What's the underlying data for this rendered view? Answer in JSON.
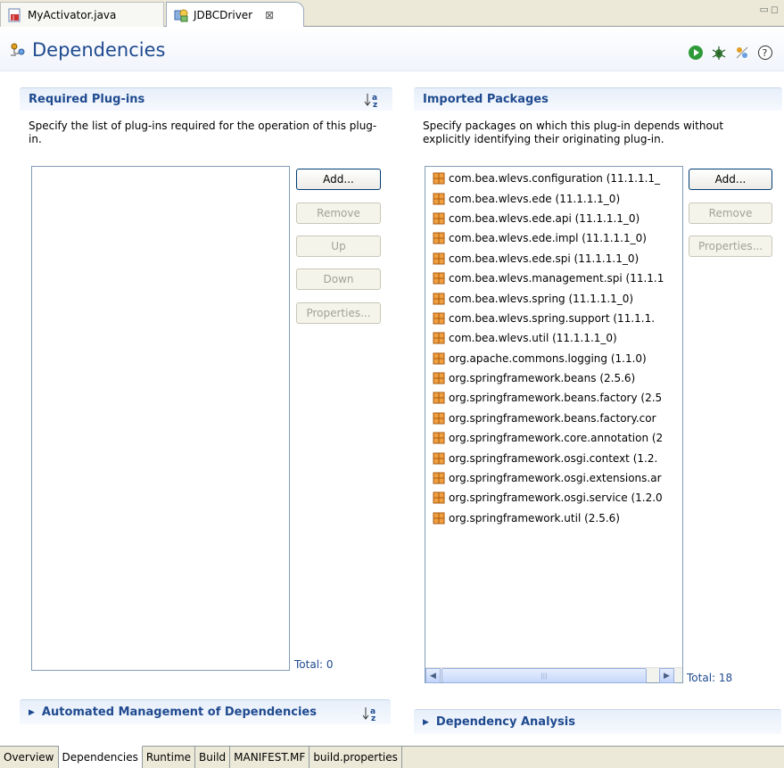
{
  "tabs": [
    {
      "label": "MyActivator.java",
      "icon": "java-file-icon"
    },
    {
      "label": "JDBCDriver",
      "icon": "plugin-manifest-icon",
      "close": "⊠"
    }
  ],
  "form": {
    "title": "Dependencies"
  },
  "required": {
    "title": "Required Plug-ins",
    "description": "Specify the list of plug-ins required for the operation of this plug-in.",
    "buttons": {
      "add": "Add...",
      "remove": "Remove",
      "up": "Up",
      "down": "Down",
      "properties": "Properties..."
    },
    "total": "Total: 0"
  },
  "imported": {
    "title": "Imported Packages",
    "description": "Specify packages on which this plug-in depends without explicitly identifying their originating plug-in.",
    "buttons": {
      "add": "Add...",
      "remove": "Remove",
      "properties": "Properties..."
    },
    "packages": [
      "com.bea.wlevs.configuration (11.1.1.1_",
      "com.bea.wlevs.ede (11.1.1.1_0)",
      "com.bea.wlevs.ede.api (11.1.1.1_0)",
      "com.bea.wlevs.ede.impl (11.1.1.1_0)",
      "com.bea.wlevs.ede.spi (11.1.1.1_0)",
      "com.bea.wlevs.management.spi (11.1.1",
      "com.bea.wlevs.spring (11.1.1.1_0)",
      "com.bea.wlevs.spring.support (11.1.1.",
      "com.bea.wlevs.util (11.1.1.1_0)",
      "org.apache.commons.logging (1.1.0)",
      "org.springframework.beans (2.5.6)",
      "org.springframework.beans.factory (2.5",
      "org.springframework.beans.factory.cor",
      "org.springframework.core.annotation (2",
      "org.springframework.osgi.context (1.2.",
      "org.springframework.osgi.extensions.ar",
      "org.springframework.osgi.service (1.2.0",
      "org.springframework.util (2.5.6)"
    ],
    "total": "Total: 18"
  },
  "automated": {
    "title": "Automated Management of Dependencies"
  },
  "analysis": {
    "title": "Dependency Analysis"
  },
  "page_tabs": [
    "Overview",
    "Dependencies",
    "Runtime",
    "Build",
    "MANIFEST.MF",
    "build.properties"
  ],
  "active_page_tab": "Dependencies",
  "colors": {
    "section_title": "#1f4a8f",
    "package_icon": "#e07b1a"
  }
}
